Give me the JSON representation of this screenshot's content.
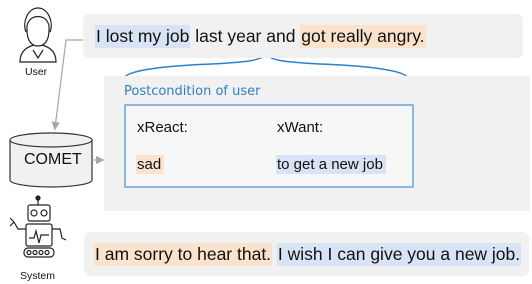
{
  "user_label": "User",
  "system_label": "System",
  "user_utterance": {
    "part1": "I lost my job",
    "part2": " last year and ",
    "part3": "got really angry."
  },
  "comet_label": "COMET",
  "postcondition": {
    "title": "Postcondition of user",
    "headers": [
      "xReact:",
      "xWant:"
    ],
    "values": [
      "sad",
      "to get a new job"
    ]
  },
  "system_utterance": {
    "part1": "I am sorry to hear that.",
    "part2": " ",
    "part3": "I wish I can give you a new job."
  },
  "colors": {
    "blue_highlight": "#d8e3f5",
    "orange_highlight": "#fbe2cc",
    "panel_gray": "#f1f1f1",
    "accent_blue": "#2f7fc7",
    "box_border": "#8ab8e3",
    "arrow_gray": "#a6a6a6"
  },
  "icons": [
    "user-icon",
    "database-icon",
    "robot-icon"
  ]
}
